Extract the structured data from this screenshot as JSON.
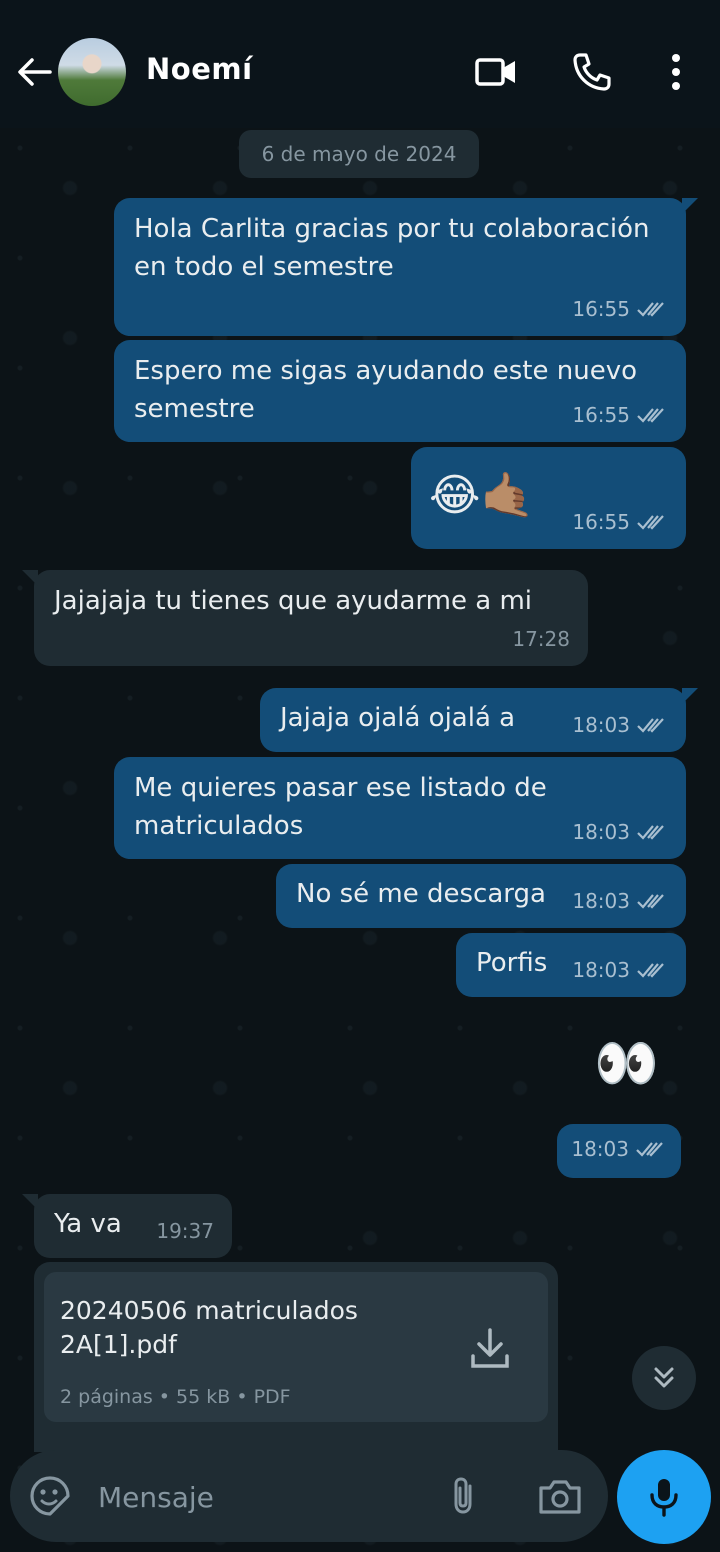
{
  "header": {
    "contact_name": "Noemí",
    "icons": [
      "back-arrow-icon",
      "video-call-icon",
      "phone-icon",
      "more-vertical-icon"
    ]
  },
  "date_chip": "6 de mayo de 2024",
  "messages": [
    {
      "dir": "out",
      "text": "Hola Carlita gracias por tu colaboración en todo el semestre",
      "time": "16:55"
    },
    {
      "dir": "out",
      "text": "Espero me sigas ayudando este nuevo semestre",
      "time": "16:55"
    },
    {
      "dir": "out",
      "text": "😂🤙🏽",
      "time": "16:55"
    },
    {
      "dir": "in",
      "text": "Jajajaja tu tienes que ayudarme a mi",
      "time": "17:28"
    },
    {
      "dir": "out",
      "text": "Jajaja ojalá ojalá a",
      "time": "18:03"
    },
    {
      "dir": "out",
      "text": "Me quieres pasar ese listado de matriculados",
      "time": "18:03"
    },
    {
      "dir": "out",
      "text": "No sé me descarga",
      "time": "18:03"
    },
    {
      "dir": "out",
      "text": "Porfis",
      "time": "18:03"
    },
    {
      "dir": "out",
      "text": "👀",
      "time": "18:03"
    },
    {
      "dir": "in",
      "text": "Ya va",
      "time": "19:37"
    }
  ],
  "document": {
    "name": "20240506 matriculados 2A[1].pdf",
    "meta": "2 páginas • 55 kB • PDF"
  },
  "composer": {
    "placeholder": "Mensaje"
  },
  "colors": {
    "outgoing_bubble": "#134d78",
    "incoming_bubble": "#1f2c33",
    "mic_button": "#1da1f2"
  }
}
